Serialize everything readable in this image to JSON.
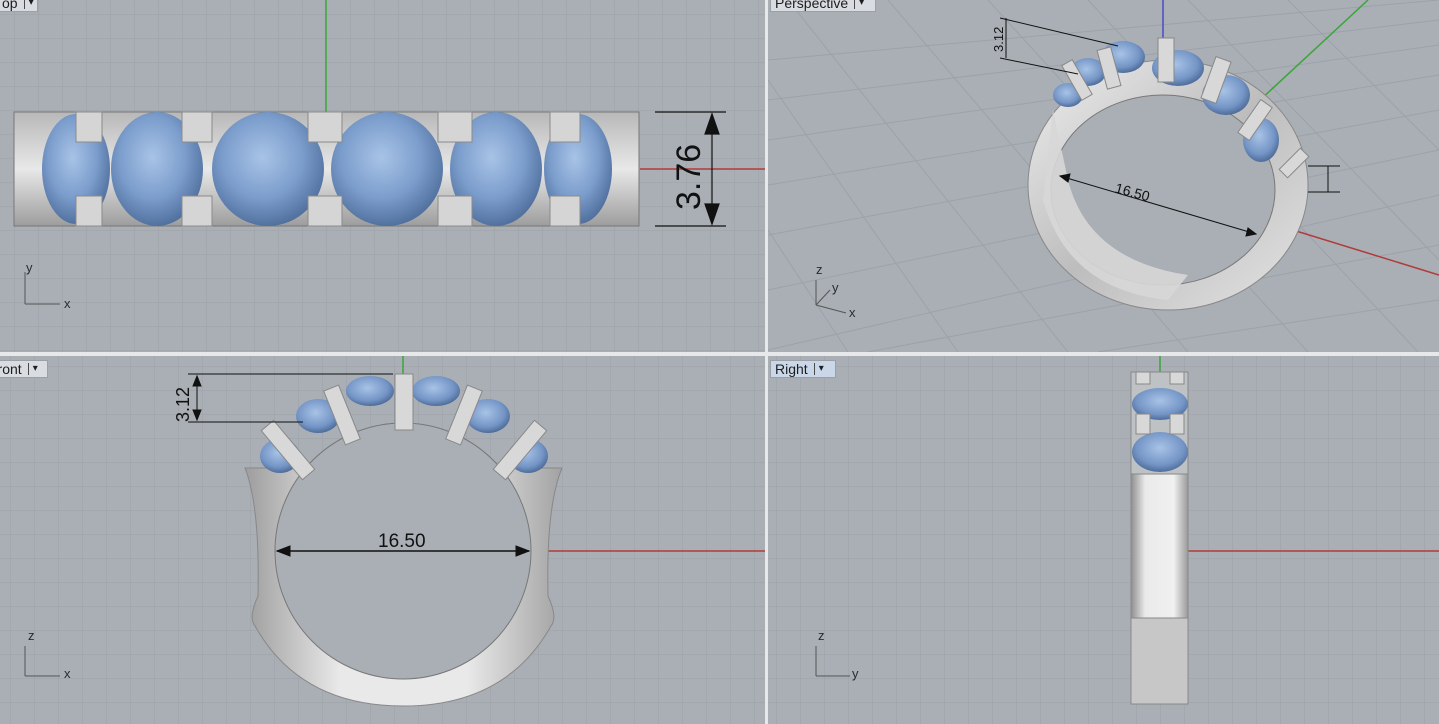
{
  "viewports": {
    "top": {
      "label": "Top",
      "axes": [
        "y",
        "x"
      ]
    },
    "perspective": {
      "label": "Perspective",
      "axes": [
        "z",
        "y",
        "x"
      ]
    },
    "front": {
      "label": "Front",
      "axes": [
        "z",
        "x"
      ]
    },
    "right": {
      "label": "Right",
      "axes": [
        "z",
        "y"
      ]
    }
  },
  "dimensions": {
    "band_width": "3.76",
    "stone_height": "3.12",
    "inner_diameter": "16.50"
  },
  "colors": {
    "viewport_bg": "#a9afb5",
    "grid_line": "#9aa1a8",
    "x_axis": "#b23a3a",
    "y_axis": "#3aa63a",
    "z_axis": "#4a4ac4",
    "metal": "#c9c9c9",
    "gem": "#7d9fcf"
  },
  "icons": [
    "dropdown-arrow-icon",
    "axis-triad-icon"
  ]
}
